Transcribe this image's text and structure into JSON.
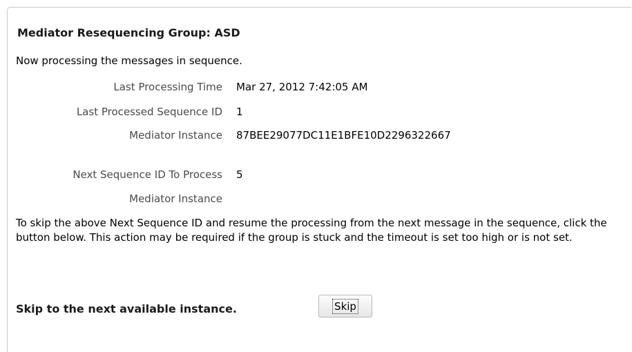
{
  "header": {
    "title": "Mediator Resequencing Group: ASD"
  },
  "status_text": "Now processing the messages in sequence.",
  "details": [
    {
      "label": "Last Processing Time",
      "value": "Mar 27, 2012 7:42:05 AM"
    },
    {
      "label": "Last Processed Sequence ID",
      "value": "1"
    },
    {
      "label": "Mediator Instance",
      "value": "87BEE29077DC11E1BFE10D2296322667"
    }
  ],
  "next": [
    {
      "label": "Next Sequence ID To Process",
      "value": "5"
    },
    {
      "label": "Mediator Instance",
      "value": ""
    }
  ],
  "info_paragraph": "To skip the above Next Sequence ID and resume the processing from the next message in the sequence, click the button below. This action may be required if the group is stuck and the timeout is set too high or is not set.",
  "skip": {
    "prompt": "Skip to the next available instance.",
    "button_label": "Skip"
  }
}
